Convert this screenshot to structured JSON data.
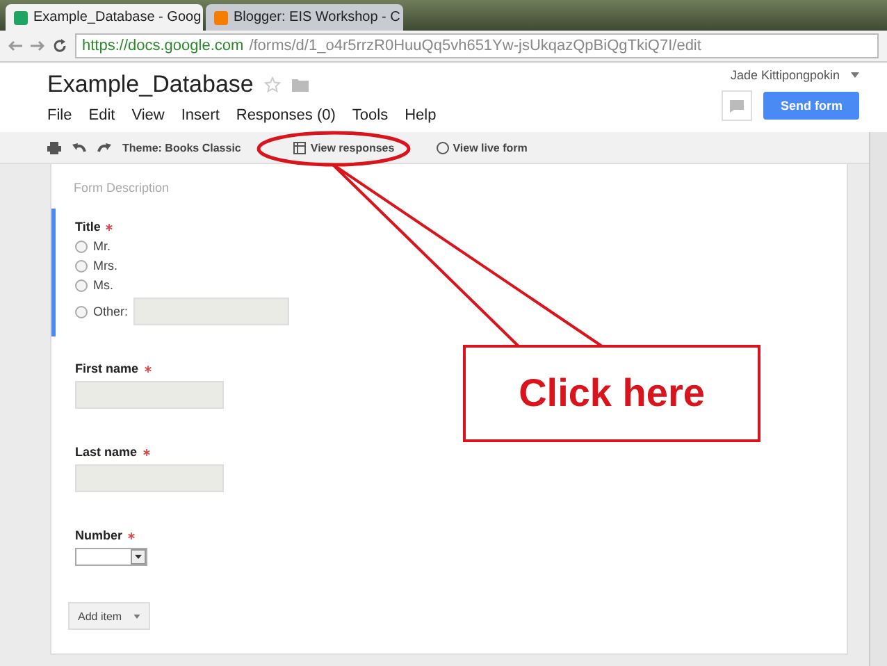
{
  "browser": {
    "tabs": [
      {
        "title": "Example_Database - Goog",
        "selected": true
      },
      {
        "title": "Blogger: EIS Workshop - C",
        "selected": false
      }
    ],
    "url_host": "https://docs.google.com",
    "url_path": "/forms/d/1_o4r5rrzR0HuuQq5vh651Yw-jsUkqazQpBiQgTkiQ7I/edit"
  },
  "header": {
    "title": "Example_Database",
    "user": "Jade Kittipongpokin",
    "send_button": "Send form",
    "menu": [
      "File",
      "Edit",
      "View",
      "Insert",
      "Responses (0)",
      "Tools",
      "Help"
    ]
  },
  "toolbar": {
    "theme": "Theme: Books Classic",
    "view_responses": "View responses",
    "view_live": "View live form"
  },
  "form": {
    "description_placeholder": "Form Description",
    "questions": [
      {
        "kind": "radio",
        "label": "Title",
        "required": true,
        "selected": true,
        "options": [
          "Mr.",
          "Mrs.",
          "Ms."
        ],
        "other": "Other:"
      },
      {
        "kind": "text",
        "label": "First name",
        "required": true,
        "selected": false
      },
      {
        "kind": "text",
        "label": "Last name",
        "required": true,
        "selected": false
      },
      {
        "kind": "dropdown",
        "label": "Number",
        "required": true,
        "selected": false
      }
    ],
    "add_item": "Add item"
  },
  "callout": {
    "text": "Click here"
  }
}
